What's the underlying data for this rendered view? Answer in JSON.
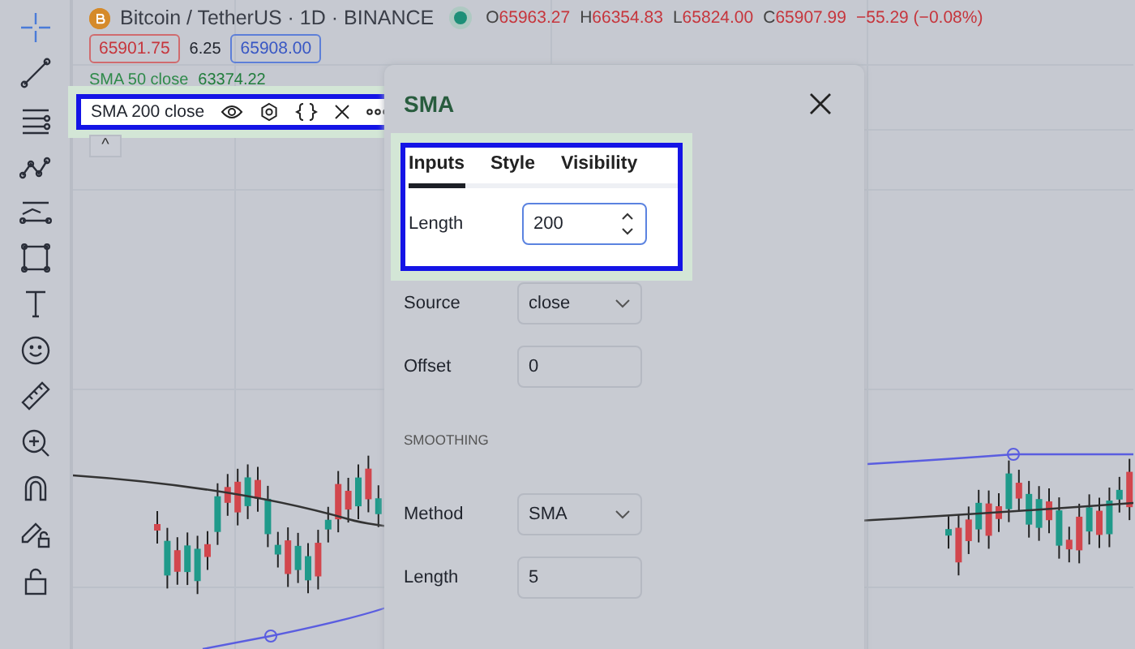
{
  "header": {
    "symbol": "Bitcoin / TetherUS · 1D · BINANCE",
    "market_open": true,
    "ohlc": [
      {
        "label": "O",
        "value": "65963.27"
      },
      {
        "label": "H",
        "value": "66354.83"
      },
      {
        "label": "L",
        "value": "65824.00"
      },
      {
        "label": "C",
        "value": "65907.99"
      }
    ],
    "change": "−55.29 (−0.08%)"
  },
  "prices": {
    "bid": "65901.75",
    "spread": "6.25",
    "ask": "65908.00"
  },
  "indicators": [
    {
      "name": "SMA 50 close",
      "value": "63374.22",
      "highlighted": false
    },
    {
      "name": "SMA 200 close",
      "highlighted": true
    }
  ],
  "collapse_button": "^",
  "dialog": {
    "title": "SMA",
    "highlighted": true,
    "tabs": [
      {
        "label": "Inputs",
        "selected": true
      },
      {
        "label": "Style",
        "selected": false
      },
      {
        "label": "Visibility",
        "selected": false
      }
    ],
    "fields": [
      {
        "kind": "number",
        "label": "Length",
        "value": "200"
      },
      {
        "kind": "select",
        "label": "Source",
        "value": "close"
      },
      {
        "kind": "text",
        "label": "Offset",
        "value": "0"
      },
      {
        "kind": "section",
        "label": "SMOOTHING"
      },
      {
        "kind": "select",
        "label": "Method",
        "value": "SMA"
      },
      {
        "kind": "text",
        "label": "Length",
        "value": "5"
      }
    ]
  }
}
